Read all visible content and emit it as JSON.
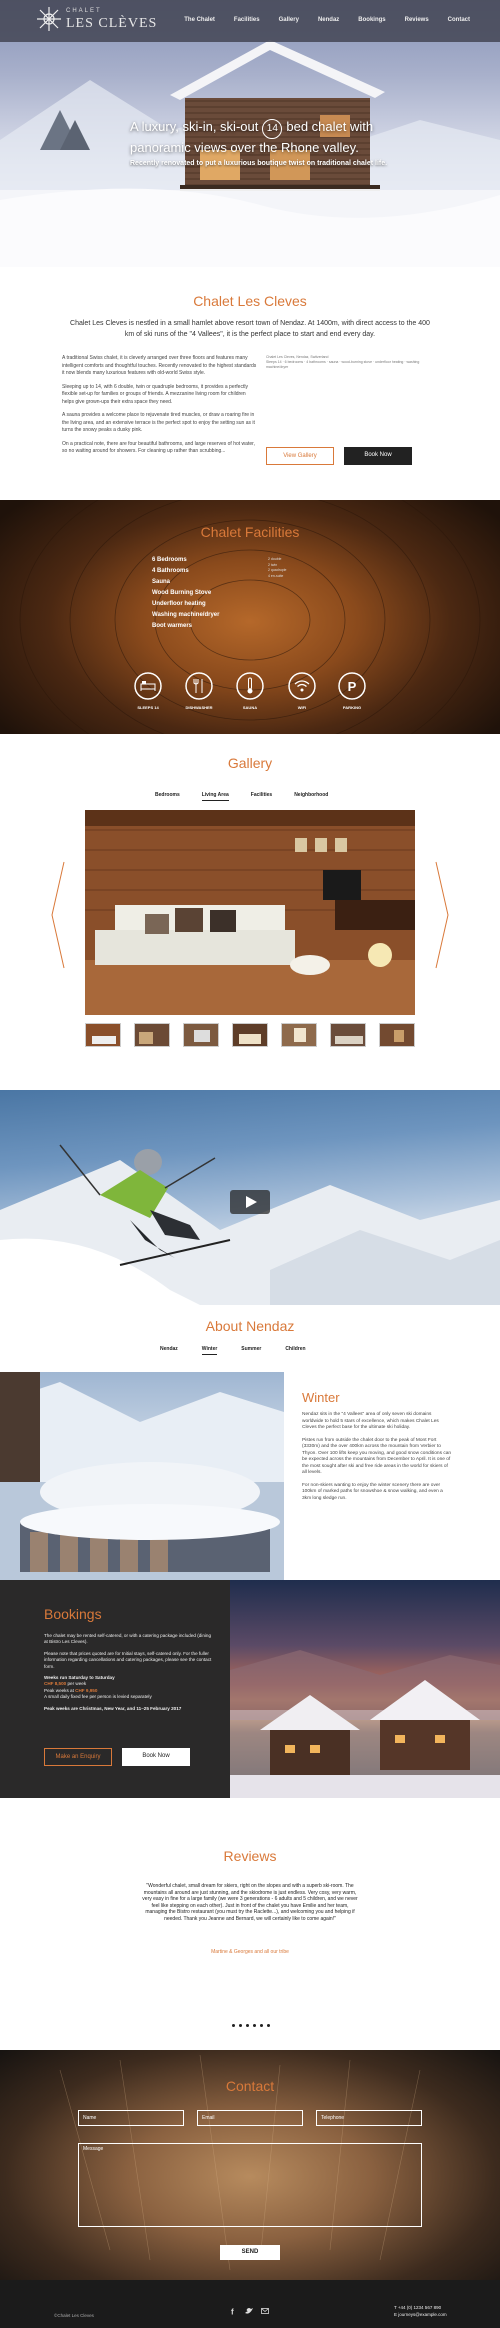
{
  "brand": {
    "small": "CHALET",
    "name": "LES CLÈVES"
  },
  "nav": [
    "The Chalet",
    "Facilities",
    "Gallery",
    "Nendaz",
    "Bookings",
    "Reviews",
    "Contact"
  ],
  "hero": {
    "headline_before": "A luxury, ski-in, ski-out",
    "bedrooms": "14",
    "headline_after": "bed chalet with panoramic views over the Rhone valley.",
    "subheadline": "Recently renovated to put a luxurious boutique twist on traditional chalet life."
  },
  "intro": {
    "title": "Chalet Les Cleves",
    "lead": "Chalet Les Cleves is nestled in a small hamlet above resort town of Nendaz. At 1400m, with direct access to the 400 km of ski runs of the \"4 Vallees\", it is the perfect place to start and end every day.",
    "paragraphs": [
      "A traditional Swiss chalet, it is cleverly arranged over three floors and features many intelligent comforts and thoughtful touches. Recently renovated to the highest standards it now blends many luxurious features with old-world Swiss style.",
      "Sleeping up to 14, with 6 double, twin or quadruple bedrooms, it provides a perfectly flexible set-up for families or groups of friends. A mezzanine living room for children helps give grown-ups their extra space they need.",
      "A sauna provides a welcome place to rejuvenate tired muscles, or draw a roaring fire in the living area, and an extensive terrace is the perfect spot to enjoy the setting sun as it turns the snowy peaks a dusky pink.",
      "On a practical note, there are four beautiful bathrooms, and large reserves of hot water, so no waiting around for showers. For cleaning up rather than scrubbing..."
    ],
    "aside": "Chalet Les Cleves, Nendaz, Switzerland\nSleeps 14 · 6 bedrooms · 4 bathrooms · sauna · wood-burning stove · underfloor heating · washing machine/dryer",
    "view_label": "View Gallery",
    "book_label": "Book Now"
  },
  "facilities": {
    "title": "Chalet Facilities",
    "list": [
      "6 Bedrooms",
      "4 Bathrooms",
      "Sauna",
      "Wood Burning Stove",
      "Underfloor heating",
      "Washing machine/dryer",
      "Boot warmers"
    ],
    "details": [
      "2 double",
      "2 twin",
      "2 quadruple",
      "4 en-suite",
      "",
      "",
      "",
      "",
      ""
    ],
    "icons": [
      {
        "icon": "bed-icon",
        "label": "SLEEPS 14"
      },
      {
        "icon": "cutlery-icon",
        "label": "DISHWASHER"
      },
      {
        "icon": "thermometer-icon",
        "label": "SAUNA"
      },
      {
        "icon": "wifi-icon",
        "label": "WIFI"
      },
      {
        "icon": "parking-icon",
        "label": "PARKING"
      }
    ]
  },
  "gallery": {
    "title": "Gallery",
    "tabs": [
      "Bedrooms",
      "Living Area",
      "Facilities",
      "Neighborhood"
    ],
    "active_tab": "Living Area"
  },
  "about": {
    "title": "About Nendaz",
    "tabs": [
      "Nendaz",
      "Winter",
      "Summer",
      "Children"
    ],
    "active_tab": "Winter",
    "section_title": "Winter",
    "paragraphs": [
      "Nendaz sits in the \"4 Vallees\" area of only seven ski domains worldwide to hold 5 stars of excellence, which makes Chalet Les Cleves the perfect base for the ultimate ski holiday.",
      "Pistes run from outside the chalet door to the peak of Mont Fort (3330m) and the over 400km across the mountain from Verbier to Thyon. Over 100 lifts keep you moving, and good snow conditions can be expected across the mountains from December to April. It is one of the most sought after ski and free ride areas in the world for skiers of all levels.",
      "For non-skiers wanting to enjoy the winter scenery there are over 100km of marked paths for snowshoe & snow walking, and even a 3km long sledge run."
    ]
  },
  "bookings": {
    "title": "Bookings",
    "paragraphs": [
      "The chalet may be rented self-catered, or with a catering package included (dining at Bistro Les Cleves).",
      "Please note that prices quoted are for Initial stays, self-catered only. For the fuller information regarding cancellations and catering packages, please see the contact form."
    ],
    "weeks_label": "Weeks run Saturday to Saturday",
    "price_week": "CHF 8,500",
    "price_week_suffix": "per week",
    "peak_label": "Peak weeks at",
    "price_peak": "CHF 9,950",
    "min_stay": "A small daily fixed fee per person is levied separately",
    "peak_dates": "Peak weeks are Christmas, New Year, and 11–25 February 2017",
    "enquiry_label": "Make an Enquiry",
    "book_label": "Book Now"
  },
  "reviews": {
    "title": "Reviews",
    "quote": "\"Wonderful chalet, small dream for skiers, right on the slopes and with a superb ski-room. The mountains all around are just stunning, and the skiodrome is just endless. Very cosy, very warm, very easy in fine for a large family (we were 3 generations - 6 adults and 5 children, and we never feel like stepping on each other). Just in front of the chalet you have Emilie and her team, managing the Bistro restaurant (you must try the Raclette...), and welcoming you and helping if needed. Thank you Jeanne and Bernard, we will certainly like to come again!\"",
    "author": "Martine & Georges and all our tribe"
  },
  "contact": {
    "title": "Contact",
    "name_ph": "Name",
    "email_ph": "Email",
    "phone_ph": "Telephone",
    "message_ph": "Message",
    "send_label": "SEND"
  },
  "footer": {
    "copyright": "©Chalet Les Cleves",
    "phone": "T +44 (0) 1234 567 890",
    "email": "E journeys@example.com"
  },
  "colors": {
    "accent": "#d9793a",
    "nav": "#464856",
    "dark": "#2a2929",
    "footer": "#1b1b1b"
  }
}
